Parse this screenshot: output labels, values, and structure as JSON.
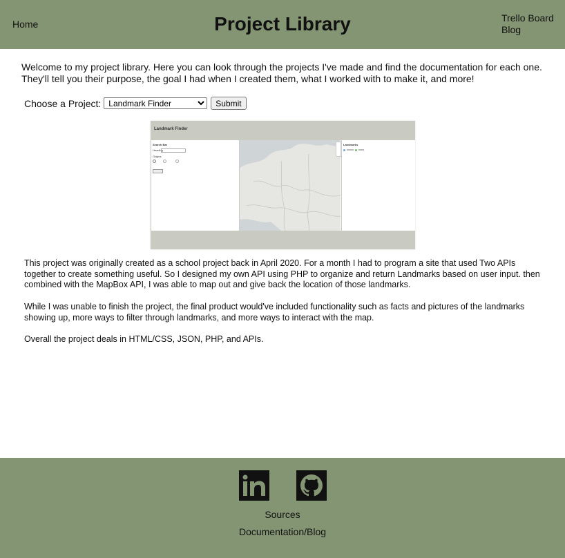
{
  "header": {
    "home_label": "Home",
    "title": "Project Library",
    "trello_label": "Trello Board",
    "blog_label": "Blog"
  },
  "intro": "Welcome to my project library. Here you can look through the projects I've made and find the documentation for each one. They'll tell you their purpose, the goal I had when I created them, what I worked with to make it, and more!",
  "chooser": {
    "label": "Choose a Project:",
    "selected": "Landmark Finder",
    "submit_label": "Submit"
  },
  "preview": {
    "title": "Landmark Finder",
    "search_heading": "Search Bar",
    "field_label": "Heading",
    "origins_label": "Origins",
    "button_label": "Search",
    "landmarks_heading": "Landmarks"
  },
  "description": {
    "p1": "This project was originally created as a school project back in April 2020. For a month I had to program a site that used Two APIs together to create something useful. So I designed my own API using PHP to organize and return Landmarks based on user input. then combined with the MapBox API, I was able to map out and give back the location of those landmarks.",
    "p2": "While I was unable to finish the project, the final product would've included functionality such as facts and pictures of the landmarks showing up, more ways to filter through landmarks, and more ways to interact with the map.",
    "p3": "Overall the project deals in HTML/CSS, JSON, PHP, and APIs."
  },
  "footer": {
    "linkedin_icon": "linkedin-icon",
    "github_icon": "github-icon",
    "sources_label": "Sources",
    "docs_label": "Documentation/Blog"
  },
  "colors": {
    "bar": "#849574",
    "preview_frame": "#c9cbc3"
  }
}
